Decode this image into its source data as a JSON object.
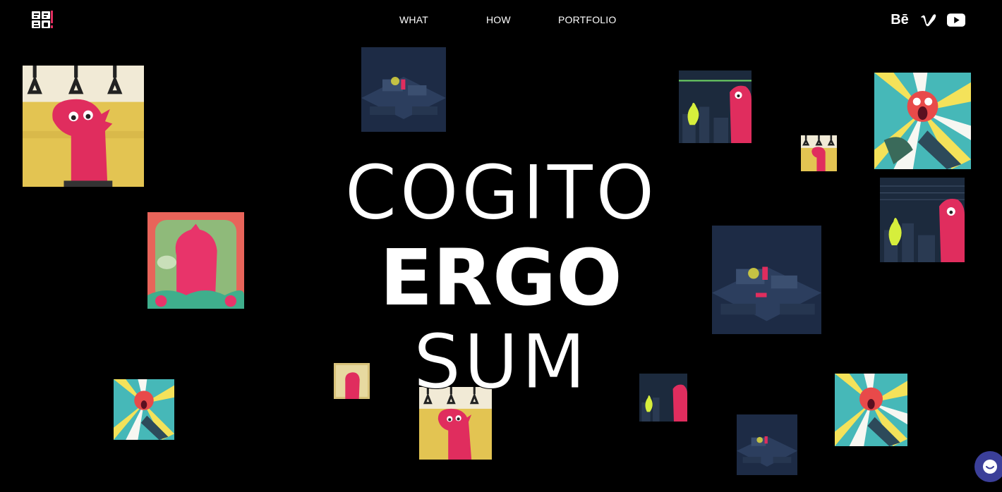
{
  "brand": {
    "logo_text": "ERGO!",
    "logo_icon": "ergo-logo-icon"
  },
  "nav": {
    "items": [
      {
        "label": "WHAT"
      },
      {
        "label": "HOW"
      },
      {
        "label": "PORTFOLIO"
      }
    ]
  },
  "social": {
    "behance_label": "Bē",
    "vimeo_icon": "vimeo-icon",
    "youtube_icon": "youtube-icon"
  },
  "hero": {
    "line1": "COGITO",
    "line2": "ERGO",
    "line3": "SUM"
  },
  "tiles": [
    {
      "scene": "subway-dino",
      "colors": {
        "bg": "#e8c84a",
        "char": "#e02d5e"
      }
    },
    {
      "scene": "office-night",
      "colors": {
        "bg": "#1d2b45",
        "char": "#e02d5e"
      }
    },
    {
      "scene": "city-ghost",
      "colors": {
        "bg": "#1c2a3d",
        "char": "#e02d5e"
      }
    },
    {
      "scene": "subway-dino",
      "colors": {
        "bg": "#e8c84a",
        "char": "#e02d5e"
      }
    },
    {
      "scene": "scream-burst",
      "colors": {
        "bg": "#3fb2b6",
        "char": "#e84a4a"
      }
    },
    {
      "scene": "dino-green",
      "colors": {
        "bg": "#8bb47a",
        "char": "#e8346a"
      }
    },
    {
      "scene": "city-ghost",
      "colors": {
        "bg": "#1c2a3d",
        "char": "#e02d5e"
      }
    },
    {
      "scene": "office-night",
      "colors": {
        "bg": "#1d2b45",
        "char": "#e02d5e"
      }
    },
    {
      "scene": "dino-small",
      "colors": {
        "bg": "#d8c27a",
        "char": "#e02d5e"
      }
    },
    {
      "scene": "scream-burst",
      "colors": {
        "bg": "#3fb2b6",
        "char": "#e84a4a"
      }
    },
    {
      "scene": "subway-dino",
      "colors": {
        "bg": "#e8c84a",
        "char": "#e02d5e"
      }
    },
    {
      "scene": "city-ghost",
      "colors": {
        "bg": "#1c2a3d",
        "char": "#e02d5e"
      }
    },
    {
      "scene": "scream-burst",
      "colors": {
        "bg": "#3fb2b6",
        "char": "#e84a4a"
      }
    },
    {
      "scene": "office-night",
      "colors": {
        "bg": "#1d2b45",
        "char": "#e02d5e"
      }
    }
  ],
  "chat": {
    "icon": "chat-icon",
    "color": "#3b3f99"
  }
}
